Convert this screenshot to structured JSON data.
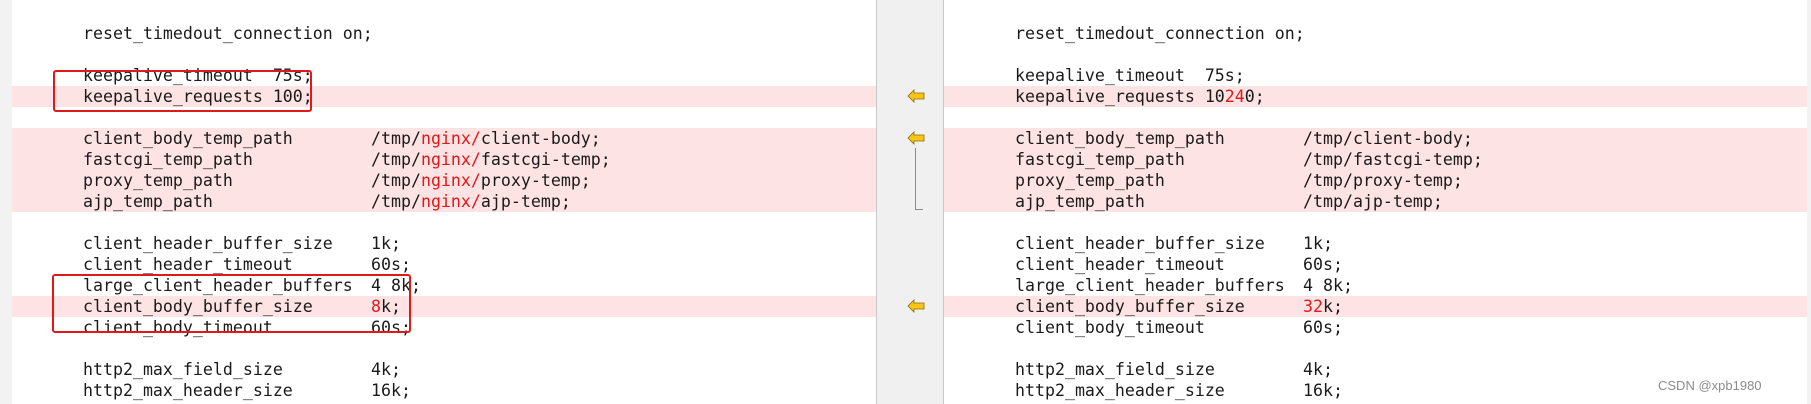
{
  "left": [
    {
      "text": "reset_timedout_connection on;",
      "val": "",
      "diff": false,
      "seg": []
    },
    {
      "text": "",
      "val": "",
      "diff": false,
      "seg": []
    },
    {
      "text": "keepalive_timeout  75s;",
      "val": "",
      "diff": false,
      "seg": []
    },
    {
      "text": "keepalive_requests 100;",
      "val": "",
      "diff": true,
      "seg": []
    },
    {
      "text": "",
      "val": "",
      "diff": false,
      "seg": []
    },
    {
      "text": "client_body_temp_path",
      "val": "",
      "diff": true,
      "seg": [
        "/tmp/",
        "nginx/",
        "client-body;"
      ]
    },
    {
      "text": "fastcgi_temp_path",
      "val": "",
      "diff": true,
      "seg": [
        "/tmp/",
        "nginx/",
        "fastcgi-temp;"
      ]
    },
    {
      "text": "proxy_temp_path",
      "val": "",
      "diff": true,
      "seg": [
        "/tmp/",
        "nginx/",
        "proxy-temp;"
      ]
    },
    {
      "text": "ajp_temp_path",
      "val": "",
      "diff": true,
      "seg": [
        "/tmp/",
        "nginx/",
        "ajp-temp;"
      ]
    },
    {
      "text": "",
      "val": "",
      "diff": false,
      "seg": []
    },
    {
      "text": "client_header_buffer_size",
      "val": "1k;",
      "diff": false,
      "seg": []
    },
    {
      "text": "client_header_timeout",
      "val": "60s;",
      "diff": false,
      "seg": []
    },
    {
      "text": "large_client_header_buffers",
      "val": "4 8k;",
      "diff": false,
      "seg": []
    },
    {
      "text": "client_body_buffer_size",
      "val": "",
      "diff": true,
      "seg": [
        "",
        "8",
        "k;"
      ]
    },
    {
      "text": "client_body_timeout",
      "val": "60s;",
      "diff": false,
      "seg": []
    },
    {
      "text": "",
      "val": "",
      "diff": false,
      "seg": []
    },
    {
      "text": "http2_max_field_size",
      "val": "4k;",
      "diff": false,
      "seg": []
    },
    {
      "text": "http2_max_header_size",
      "val": "16k;",
      "diff": false,
      "seg": []
    }
  ],
  "right": [
    {
      "text": "reset_timedout_connection on;",
      "val": "",
      "diff": false,
      "seg": []
    },
    {
      "text": "",
      "val": "",
      "diff": false,
      "seg": []
    },
    {
      "text": "keepalive_timeout  75s;",
      "val": "",
      "diff": false,
      "seg": []
    },
    {
      "text": "",
      "val": "",
      "diff": true,
      "seg": [
        "keepalive_requests 10",
        "24",
        "0;"
      ]
    },
    {
      "text": "",
      "val": "",
      "diff": false,
      "seg": []
    },
    {
      "text": "client_body_temp_path",
      "val": "/tmp/client-body;",
      "diff": true,
      "seg": []
    },
    {
      "text": "fastcgi_temp_path",
      "val": "/tmp/fastcgi-temp;",
      "diff": true,
      "seg": []
    },
    {
      "text": "proxy_temp_path",
      "val": "/tmp/proxy-temp;",
      "diff": true,
      "seg": []
    },
    {
      "text": "ajp_temp_path",
      "val": "/tmp/ajp-temp;",
      "diff": true,
      "seg": []
    },
    {
      "text": "",
      "val": "",
      "diff": false,
      "seg": []
    },
    {
      "text": "client_header_buffer_size",
      "val": "1k;",
      "diff": false,
      "seg": []
    },
    {
      "text": "client_header_timeout",
      "val": "60s;",
      "diff": false,
      "seg": []
    },
    {
      "text": "large_client_header_buffers",
      "val": "4 8k;",
      "diff": false,
      "seg": []
    },
    {
      "text": "client_body_buffer_size",
      "val": "",
      "diff": true,
      "seg": [
        "",
        "32",
        "k;"
      ]
    },
    {
      "text": "client_body_timeout",
      "val": "60s;",
      "diff": false,
      "seg": []
    },
    {
      "text": "",
      "val": "",
      "diff": false,
      "seg": []
    },
    {
      "text": "http2_max_field_size",
      "val": "4k;",
      "diff": false,
      "seg": []
    },
    {
      "text": "http2_max_header_size",
      "val": "16k;",
      "diff": false,
      "seg": []
    }
  ],
  "gutter": {
    "arrow_icon": "copy-left-arrow-icon",
    "arrow_color": "#f5c518",
    "arrow_rows": [
      3,
      5,
      13
    ]
  },
  "colors": {
    "diff_bg": "#fde3e3",
    "highlight": "#e01818",
    "annotation_box": "#e0191b"
  },
  "watermark": "CSDN @xpb1980"
}
